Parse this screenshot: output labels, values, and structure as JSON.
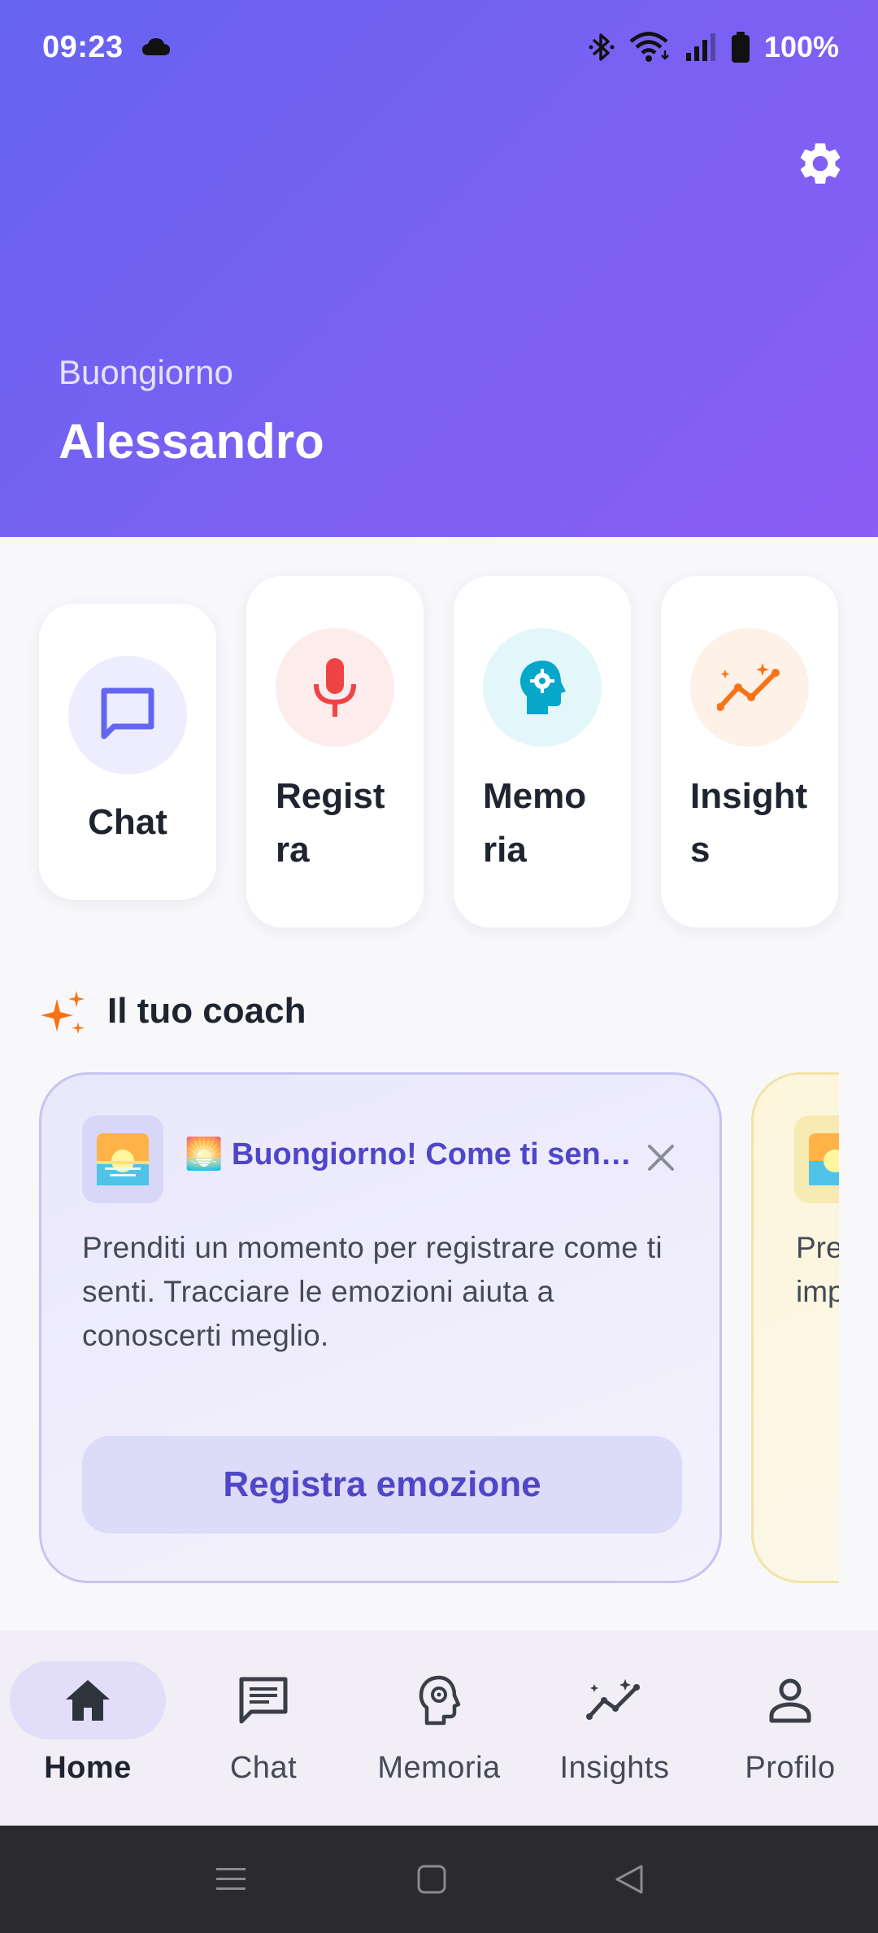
{
  "status_bar": {
    "time": "09:23",
    "battery": "100%"
  },
  "header": {
    "greeting": "Buongiorno",
    "name": "Alessandro"
  },
  "quick_actions": [
    {
      "label": "Chat",
      "icon": "chat-bubble-icon",
      "color": "#6366f1",
      "bg": "#eeedfd"
    },
    {
      "label": "Regist\nra",
      "icon": "microphone-icon",
      "color": "#ef4444",
      "bg": "#fdecec"
    },
    {
      "label": "Memo\nria",
      "icon": "brain-head-icon",
      "color": "#06a7c9",
      "bg": "#e3f7fb"
    },
    {
      "label": "Insight\ns",
      "icon": "insights-chart-icon",
      "color": "#f97316",
      "bg": "#fef1e7"
    }
  ],
  "coach": {
    "section_title": "Il tuo coach",
    "cards": [
      {
        "emoji": "🌅",
        "title": "🌅 Buongiorno! Come ti sentì...",
        "body": "Prenditi un momento per registrare come ti senti. Tracciare le emozioni aiuta a conoscerti meglio.",
        "action": "Registra emozione"
      },
      {
        "emoji": "🌅",
        "body_line1": "Pre",
        "body_line2": "imp"
      }
    ]
  },
  "bottom_nav": {
    "items": [
      {
        "label": "Home",
        "icon": "home-icon",
        "active": true
      },
      {
        "label": "Chat",
        "icon": "chat-icon",
        "active": false
      },
      {
        "label": "Memoria",
        "icon": "memoria-icon",
        "active": false
      },
      {
        "label": "Insights",
        "icon": "insights-icon",
        "active": false
      },
      {
        "label": "Profilo",
        "icon": "profile-icon",
        "active": false
      }
    ]
  },
  "colors": {
    "header_start": "#6663f1",
    "header_end": "#8b5cf6",
    "accent": "#4f46c8",
    "coach_sparkle": "#f97316"
  }
}
